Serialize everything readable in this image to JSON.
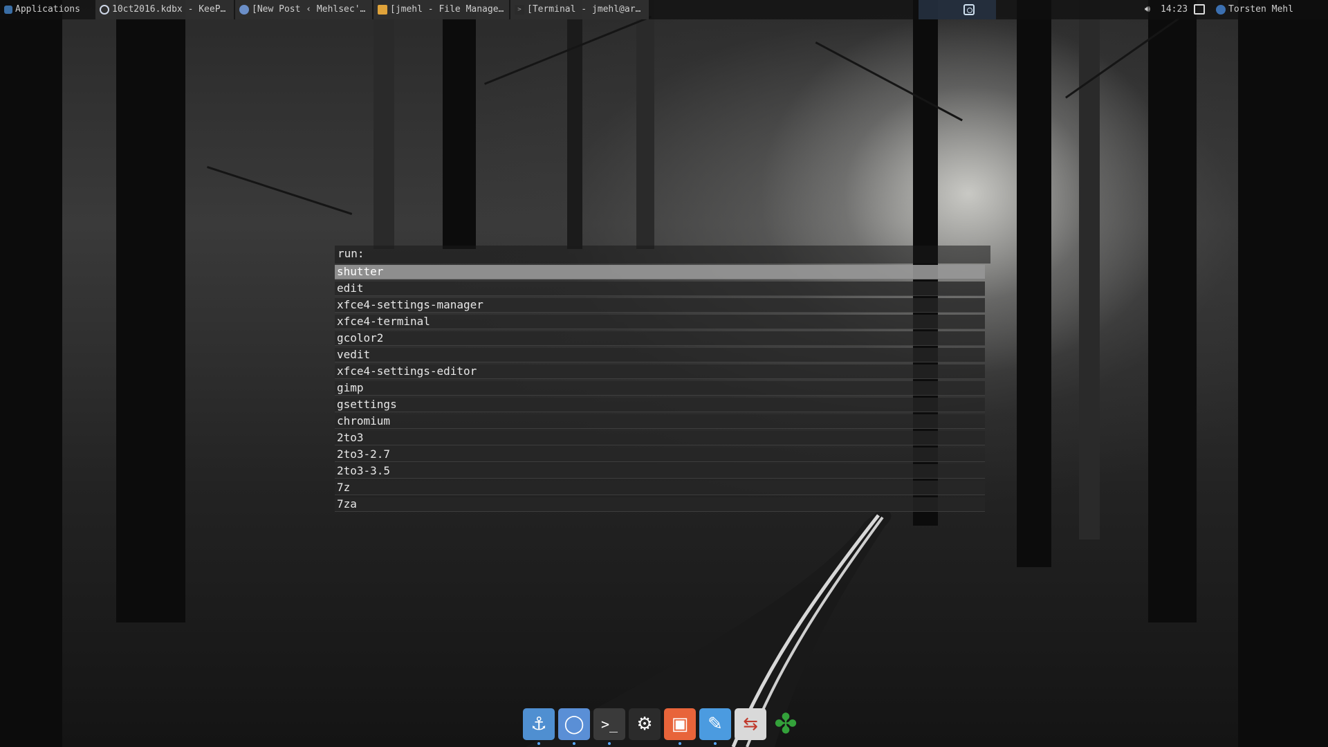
{
  "panel": {
    "apps_label": "Applications",
    "tasks": [
      {
        "label": "10ct2016.kdbx - KeeP…"
      },
      {
        "label": "[New Post ‹ Mehlsec'…"
      },
      {
        "label": "[jmehl - File Manage…"
      },
      {
        "label": "[Terminal - jmehl@ar…"
      }
    ],
    "clock": "14:23",
    "user": "Torsten Mehl"
  },
  "launcher": {
    "prompt": "run:",
    "input_value": "",
    "commands": [
      "shutter",
      "edit",
      "xfce4-settings-manager",
      "xfce4-terminal",
      "gcolor2",
      "vedit",
      "xfce4-settings-editor",
      "gimp",
      "gsettings",
      "chromium",
      "2to3",
      "2to3-2.7",
      "2to3-3.5",
      "7z",
      "7za"
    ],
    "selected_index": 0
  },
  "dock": {
    "icons": [
      {
        "name": "anchor-icon",
        "glyph": "⚓",
        "color": "#4f8fd1",
        "running": true
      },
      {
        "name": "chromium-icon",
        "glyph": "◯",
        "color": "#5a8fd6",
        "running": true
      },
      {
        "name": "terminal-icon",
        "glyph": ">_",
        "color": "#3a3a3a",
        "running": true
      },
      {
        "name": "steam-icon",
        "glyph": "⚙",
        "color": "#2b2b2b",
        "running": false
      },
      {
        "name": "archive-icon",
        "glyph": "▣",
        "color": "#e8643a",
        "running": true
      },
      {
        "name": "settings-icon",
        "glyph": "✎",
        "color": "#4b9be0",
        "running": true
      },
      {
        "name": "toggle-icon",
        "glyph": "⇆",
        "color": "#d9d9d9",
        "running": false
      },
      {
        "name": "clover-icon",
        "glyph": "✤",
        "color": "#33a13a",
        "running": false
      }
    ]
  }
}
